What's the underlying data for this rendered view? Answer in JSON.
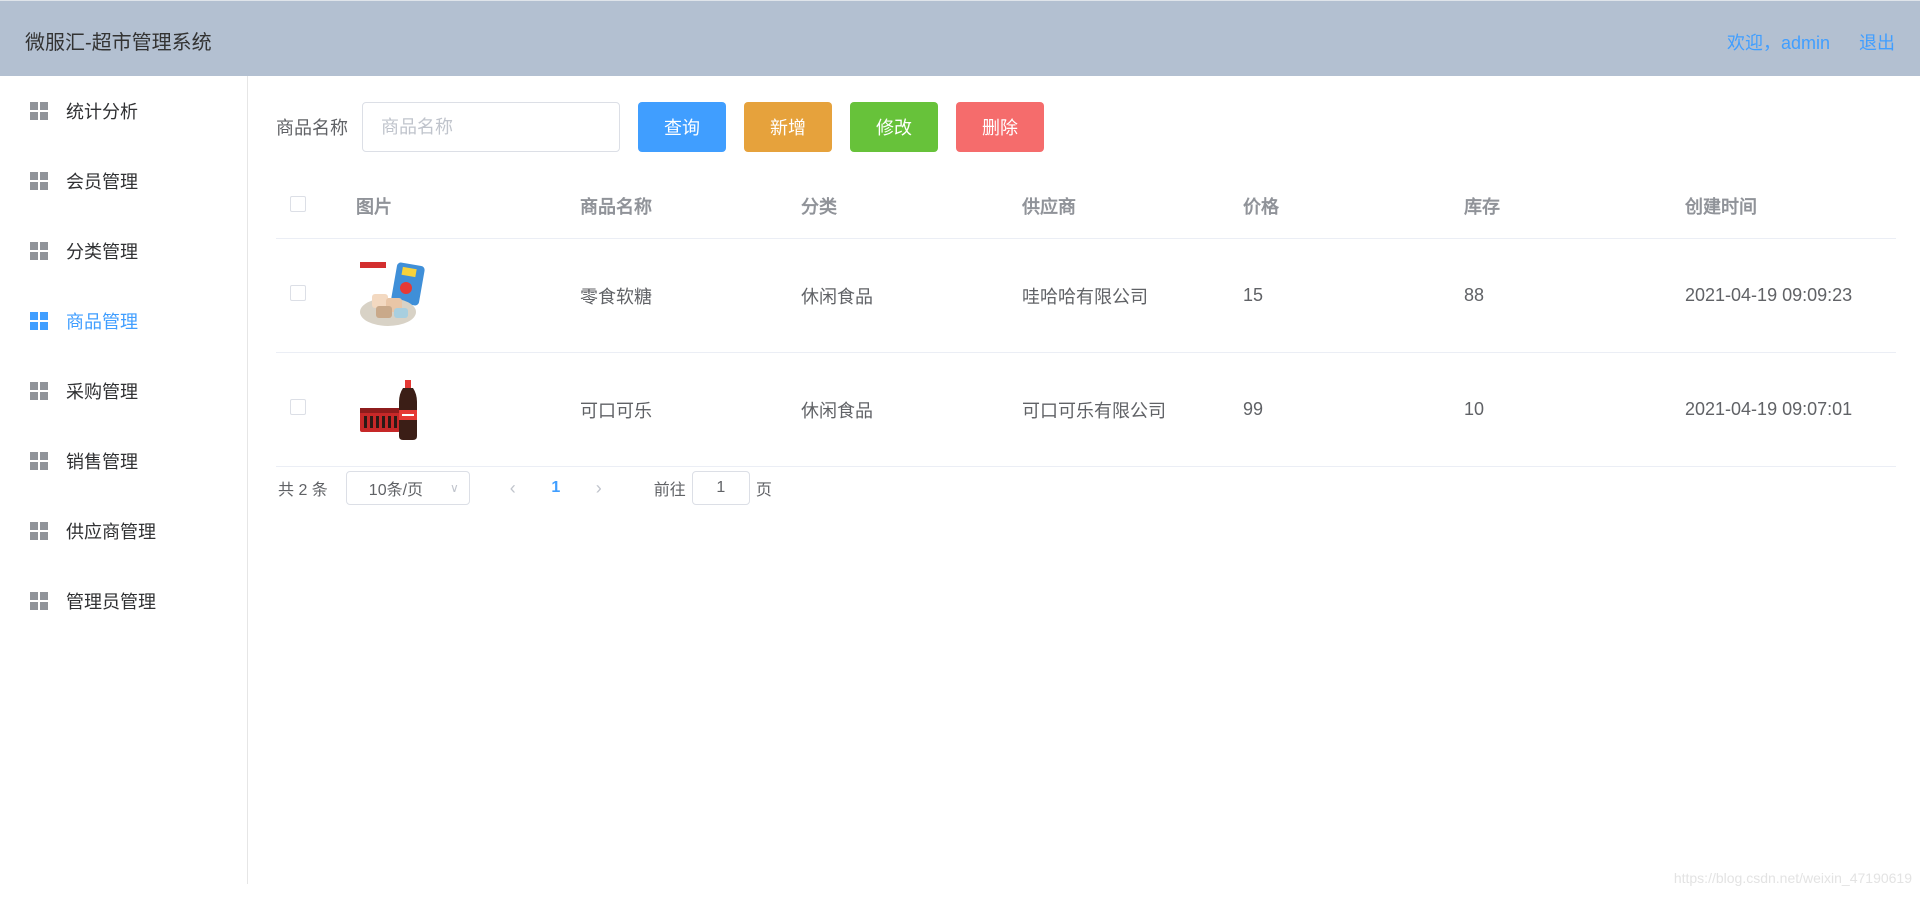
{
  "header": {
    "title": "微服汇-超市管理系统",
    "welcome": "欢迎，admin",
    "logout": "退出"
  },
  "sidebar": {
    "items": [
      {
        "label": "统计分析",
        "icon": "grid-icon"
      },
      {
        "label": "会员管理",
        "icon": "grid-icon"
      },
      {
        "label": "分类管理",
        "icon": "grid-icon"
      },
      {
        "label": "商品管理",
        "icon": "grid-icon",
        "active": true
      },
      {
        "label": "采购管理",
        "icon": "grid-icon"
      },
      {
        "label": "销售管理",
        "icon": "grid-icon"
      },
      {
        "label": "供应商管理",
        "icon": "grid-icon"
      },
      {
        "label": "管理员管理",
        "icon": "grid-icon"
      }
    ]
  },
  "toolbar": {
    "search_label": "商品名称",
    "search_placeholder": "商品名称",
    "search_value": "",
    "query_label": "查询",
    "add_label": "新增",
    "edit_label": "修改",
    "delete_label": "删除"
  },
  "table": {
    "headers": [
      "图片",
      "商品名称",
      "分类",
      "供应商",
      "价格",
      "库存",
      "创建时间"
    ],
    "rows": [
      {
        "image": "candy-product-image",
        "name": "零食软糖",
        "category": "休闲食品",
        "supplier": "哇哈哈有限公司",
        "price": "15",
        "stock": "88",
        "created": "2021-04-19 09:09:23"
      },
      {
        "image": "cola-product-image",
        "name": "可口可乐",
        "category": "休闲食品",
        "supplier": "可口可乐有限公司",
        "price": "99",
        "stock": "10",
        "created": "2021-04-19 09:07:01"
      }
    ]
  },
  "pagination": {
    "total": "共 2 条",
    "page_size": "10条/页",
    "current_page": "1",
    "goto_prefix": "前往",
    "goto_value": "1",
    "goto_suffix": "页"
  },
  "watermark": "https://blog.csdn.net/weixin_47190619",
  "colors": {
    "header_bg": "#b3c0d1",
    "accent": "#409eff",
    "warning": "#e6a23c",
    "success": "#67c23a",
    "danger": "#f56c6c"
  }
}
